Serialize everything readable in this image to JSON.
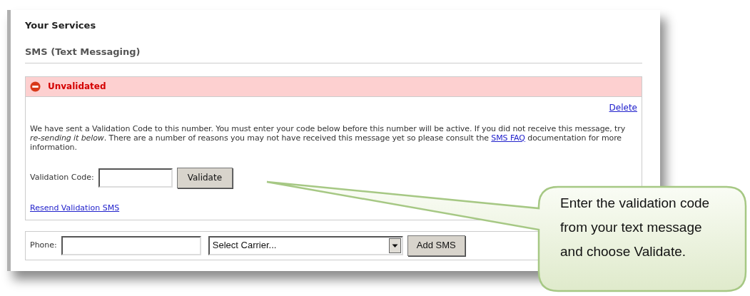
{
  "page": {
    "title": "Your Services",
    "section": "SMS (Text Messaging)"
  },
  "status": {
    "kind": "error",
    "label": "Unvalidated"
  },
  "delete_link": "Delete",
  "message": {
    "before": "We have sent a Validation Code to this number. You must enter your code below before this number will be active. If you did not receive this message, try *re-sending it below*. There are a number of reasons you may not have received this message yet so please consult the ",
    "link": "SMS FAQ",
    "after": " documentation for more information."
  },
  "validation": {
    "label": "Validation Code:",
    "button": "Validate"
  },
  "resend_link": "Resend Validation SMS",
  "add_form": {
    "phone_label": "Phone:",
    "carrier": "Select Carrier...",
    "button": "Add SMS"
  },
  "callout": {
    "lines": [
      "Enter the validation code",
      "from your text message",
      "and choose Validate."
    ]
  }
}
